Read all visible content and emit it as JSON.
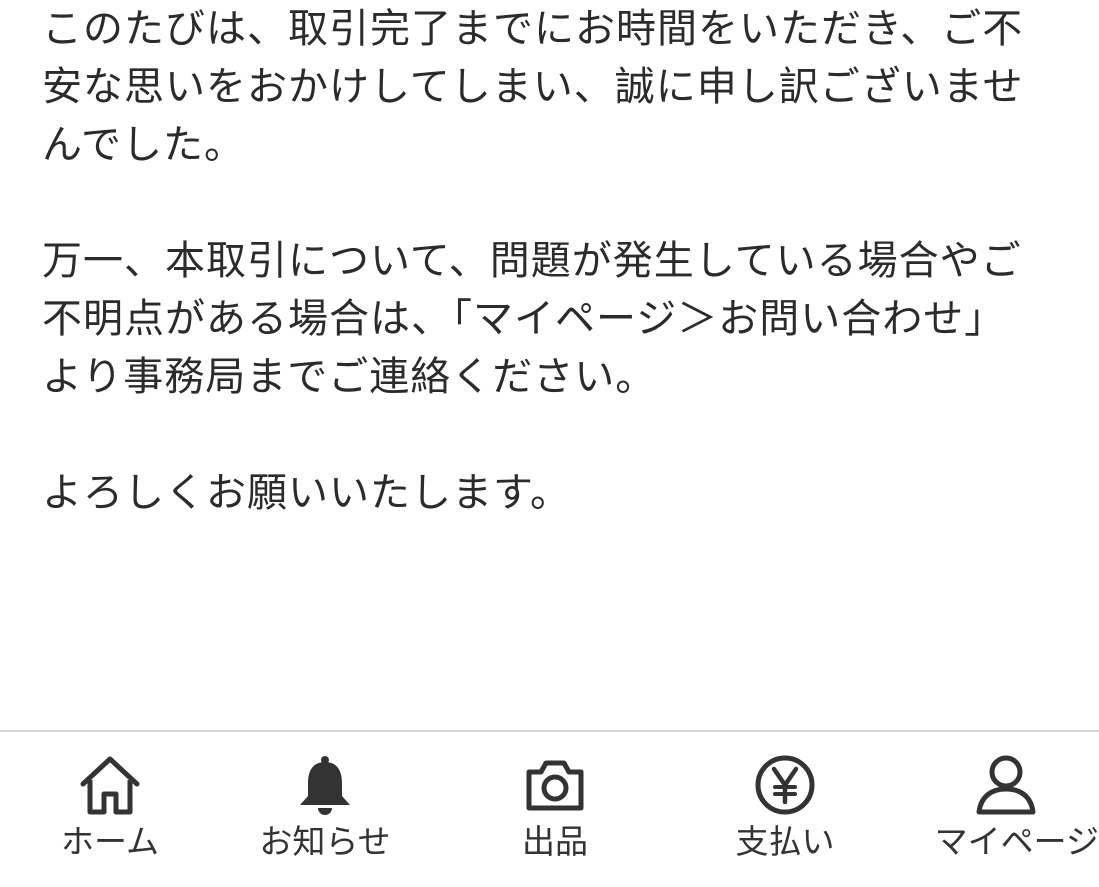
{
  "message": {
    "paragraphs": [
      "このたびは、取引完了までにお時間をいただき、ご不\n安な思いをおかけしてしまい、誠に申し訳ございませ\nんでした。",
      "万一、本取引について、問題が発生している場合やご\n不明点がある場合は、「マイページ＞お問い合わせ」\nより事務局までご連絡ください。",
      "よろしくお願いいたします。"
    ]
  },
  "tabbar": {
    "items": [
      {
        "label": "ホーム",
        "icon": "home-icon"
      },
      {
        "label": "お知らせ",
        "icon": "bell-icon"
      },
      {
        "label": "出品",
        "icon": "camera-icon"
      },
      {
        "label": "支払い",
        "icon": "yen-icon"
      },
      {
        "label": "マイページ",
        "icon": "user-icon"
      }
    ]
  },
  "colors": {
    "text": "#2b2b2b",
    "icon": "#333333",
    "divider": "#d6d6d6",
    "background": "#ffffff"
  }
}
